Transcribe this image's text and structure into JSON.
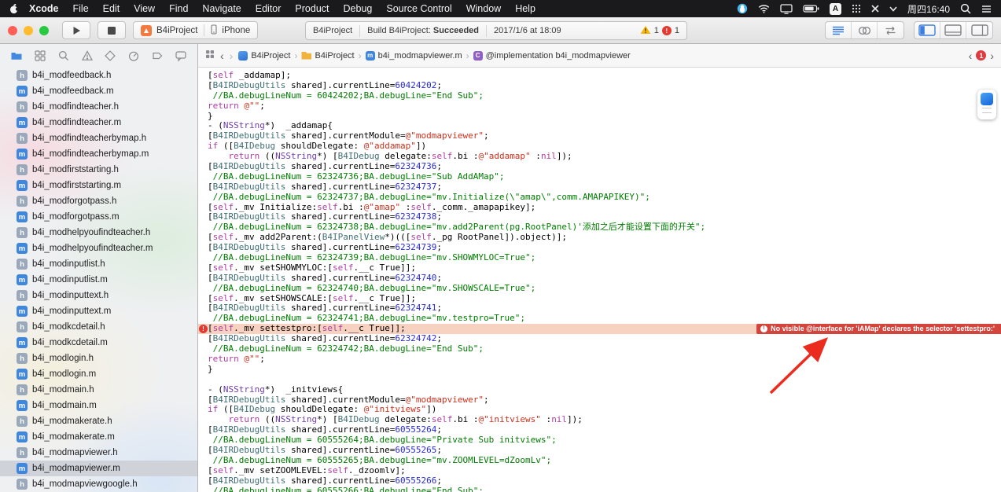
{
  "menubar": {
    "items": [
      "Xcode",
      "File",
      "Edit",
      "View",
      "Find",
      "Navigate",
      "Editor",
      "Product",
      "Debug",
      "Source Control",
      "Window",
      "Help"
    ],
    "status": {
      "time": "周四16:40",
      "input_method": "A"
    }
  },
  "toolbar": {
    "scheme": {
      "project": "B4iProject",
      "device": "iPhone"
    },
    "activity": {
      "project": "B4iProject",
      "build_prefix": "Build B4iProject:",
      "build_result": "Succeeded",
      "timestamp": "2017/1/6 at 18:09",
      "warning_count": "1",
      "error_count": "1"
    }
  },
  "sidebar": {
    "files": [
      {
        "ext": "h",
        "name": "b4i_modfeedback.h"
      },
      {
        "ext": "m",
        "name": "b4i_modfeedback.m"
      },
      {
        "ext": "h",
        "name": "b4i_modfindteacher.h"
      },
      {
        "ext": "m",
        "name": "b4i_modfindteacher.m"
      },
      {
        "ext": "h",
        "name": "b4i_modfindteacherbymap.h"
      },
      {
        "ext": "m",
        "name": "b4i_modfindteacherbymap.m"
      },
      {
        "ext": "h",
        "name": "b4i_modfirststarting.h"
      },
      {
        "ext": "m",
        "name": "b4i_modfirststarting.m"
      },
      {
        "ext": "h",
        "name": "b4i_modforgotpass.h"
      },
      {
        "ext": "m",
        "name": "b4i_modforgotpass.m"
      },
      {
        "ext": "h",
        "name": "b4i_modhelpyoufindteacher.h"
      },
      {
        "ext": "m",
        "name": "b4i_modhelpyoufindteacher.m"
      },
      {
        "ext": "h",
        "name": "b4i_modinputlist.h"
      },
      {
        "ext": "m",
        "name": "b4i_modinputlist.m"
      },
      {
        "ext": "h",
        "name": "b4i_modinputtext.h"
      },
      {
        "ext": "m",
        "name": "b4i_modinputtext.m"
      },
      {
        "ext": "h",
        "name": "b4i_modkcdetail.h"
      },
      {
        "ext": "m",
        "name": "b4i_modkcdetail.m"
      },
      {
        "ext": "h",
        "name": "b4i_modlogin.h"
      },
      {
        "ext": "m",
        "name": "b4i_modlogin.m"
      },
      {
        "ext": "h",
        "name": "b4i_modmain.h"
      },
      {
        "ext": "m",
        "name": "b4i_modmain.m"
      },
      {
        "ext": "h",
        "name": "b4i_modmakerate.h"
      },
      {
        "ext": "m",
        "name": "b4i_modmakerate.m"
      },
      {
        "ext": "h",
        "name": "b4i_modmapviewer.h"
      },
      {
        "ext": "m",
        "name": "b4i_modmapviewer.m",
        "selected": true
      },
      {
        "ext": "h",
        "name": "b4i_modmapviewgoogle.h"
      }
    ]
  },
  "jumpbar": {
    "crumbs": [
      {
        "icon": "project",
        "glyph": "",
        "label": "B4iProject"
      },
      {
        "icon": "folder",
        "glyph": "",
        "label": "B4iProject"
      },
      {
        "icon": "file",
        "glyph": "m",
        "label": "b4i_modmapviewer.m"
      },
      {
        "icon": "class",
        "glyph": "C",
        "label": "@implementation b4i_modmapviewer"
      }
    ],
    "issue_count": "1"
  },
  "editor": {
    "error_banner": "No visible @interface for 'iAMap' declares the selector 'settestpro:'",
    "lines": [
      {
        "seg": [
          [
            "p",
            "["
          ],
          [
            "k",
            "self"
          ],
          [
            "p",
            " _addamap];"
          ]
        ]
      },
      {
        "seg": [
          [
            "p",
            "["
          ],
          [
            "u",
            "B4IRDebugUtils"
          ],
          [
            "p",
            " shared].currentLine="
          ],
          [
            "n",
            "60424202"
          ],
          [
            "p",
            ";"
          ]
        ]
      },
      {
        "seg": [
          [
            "c",
            " //BA.debugLineNum = 60424202;BA.debugLine=\"End Sub\";"
          ]
        ]
      },
      {
        "seg": [
          [
            "k",
            "return"
          ],
          [
            "p",
            " "
          ],
          [
            "s",
            "@\"\""
          ],
          [
            "p",
            ";"
          ]
        ]
      },
      {
        "seg": [
          [
            "p",
            "}"
          ]
        ]
      },
      {
        "seg": [
          [
            "p",
            "- ("
          ],
          [
            "t",
            "NSString"
          ],
          [
            "p",
            "*)  _addamap{"
          ]
        ]
      },
      {
        "seg": [
          [
            "p",
            "["
          ],
          [
            "u",
            "B4IRDebugUtils"
          ],
          [
            "p",
            " shared].currentModule="
          ],
          [
            "s",
            "@\"modmapviewer\""
          ],
          [
            "p",
            ";"
          ]
        ]
      },
      {
        "seg": [
          [
            "k",
            "if"
          ],
          [
            "p",
            " (["
          ],
          [
            "u",
            "B4IDebug"
          ],
          [
            "p",
            " shouldDelegate: "
          ],
          [
            "s",
            "@\"addamap\""
          ],
          [
            "p",
            "])"
          ]
        ]
      },
      {
        "seg": [
          [
            "p",
            "    "
          ],
          [
            "k",
            "return"
          ],
          [
            "p",
            " (("
          ],
          [
            "t",
            "NSString"
          ],
          [
            "p",
            "*) ["
          ],
          [
            "u",
            "B4IDebug"
          ],
          [
            "p",
            " delegate:"
          ],
          [
            "k",
            "self"
          ],
          [
            "p",
            ".bi :"
          ],
          [
            "s",
            "@\"addamap\""
          ],
          [
            "p",
            " :"
          ],
          [
            "k",
            "nil"
          ],
          [
            "p",
            "]);"
          ]
        ]
      },
      {
        "seg": [
          [
            "p",
            "["
          ],
          [
            "u",
            "B4IRDebugUtils"
          ],
          [
            "p",
            " shared].currentLine="
          ],
          [
            "n",
            "62324736"
          ],
          [
            "p",
            ";"
          ]
        ]
      },
      {
        "seg": [
          [
            "c",
            " //BA.debugLineNum = 62324736;BA.debugLine=\"Sub AddAMap\";"
          ]
        ]
      },
      {
        "seg": [
          [
            "p",
            "["
          ],
          [
            "u",
            "B4IRDebugUtils"
          ],
          [
            "p",
            " shared].currentLine="
          ],
          [
            "n",
            "62324737"
          ],
          [
            "p",
            ";"
          ]
        ]
      },
      {
        "seg": [
          [
            "c",
            " //BA.debugLineNum = 62324737;BA.debugLine=\"mv.Initialize(\\\"amap\\\",comm.AMAPAPIKEY)\";"
          ]
        ]
      },
      {
        "seg": [
          [
            "p",
            "["
          ],
          [
            "k",
            "self"
          ],
          [
            "p",
            "._mv Initialize:"
          ],
          [
            "k",
            "self"
          ],
          [
            "p",
            ".bi :"
          ],
          [
            "s",
            "@\"amap\""
          ],
          [
            "p",
            " :"
          ],
          [
            "k",
            "self"
          ],
          [
            "p",
            "._comm._amapapikey];"
          ]
        ]
      },
      {
        "seg": [
          [
            "p",
            "["
          ],
          [
            "u",
            "B4IRDebugUtils"
          ],
          [
            "p",
            " shared].currentLine="
          ],
          [
            "n",
            "62324738"
          ],
          [
            "p",
            ";"
          ]
        ]
      },
      {
        "seg": [
          [
            "c",
            " //BA.debugLineNum = 62324738;BA.debugLine=\"mv.add2Parent(pg.RootPanel)'添加之后才能设置下面的开关\";"
          ]
        ]
      },
      {
        "seg": [
          [
            "p",
            "["
          ],
          [
            "k",
            "self"
          ],
          [
            "p",
            "._mv add2Parent:("
          ],
          [
            "u",
            "B4IPanelView"
          ],
          [
            "p",
            "*)((["
          ],
          [
            "k",
            "self"
          ],
          [
            "p",
            "._pg RootPanel]).object)];"
          ]
        ]
      },
      {
        "seg": [
          [
            "p",
            "["
          ],
          [
            "u",
            "B4IRDebugUtils"
          ],
          [
            "p",
            " shared].currentLine="
          ],
          [
            "n",
            "62324739"
          ],
          [
            "p",
            ";"
          ]
        ]
      },
      {
        "seg": [
          [
            "c",
            " //BA.debugLineNum = 62324739;BA.debugLine=\"mv.SHOWMYLOC=True\";"
          ]
        ]
      },
      {
        "seg": [
          [
            "p",
            "["
          ],
          [
            "k",
            "self"
          ],
          [
            "p",
            "._mv setSHOWMYLOC:["
          ],
          [
            "k",
            "self"
          ],
          [
            "p",
            ".__c True]];"
          ]
        ]
      },
      {
        "seg": [
          [
            "p",
            "["
          ],
          [
            "u",
            "B4IRDebugUtils"
          ],
          [
            "p",
            " shared].currentLine="
          ],
          [
            "n",
            "62324740"
          ],
          [
            "p",
            ";"
          ]
        ]
      },
      {
        "seg": [
          [
            "c",
            " //BA.debugLineNum = 62324740;BA.debugLine=\"mv.SHOWSCALE=True\";"
          ]
        ]
      },
      {
        "seg": [
          [
            "p",
            "["
          ],
          [
            "k",
            "self"
          ],
          [
            "p",
            "._mv setSHOWSCALE:["
          ],
          [
            "k",
            "self"
          ],
          [
            "p",
            ".__c True]];"
          ]
        ]
      },
      {
        "seg": [
          [
            "p",
            "["
          ],
          [
            "u",
            "B4IRDebugUtils"
          ],
          [
            "p",
            " shared].currentLine="
          ],
          [
            "n",
            "62324741"
          ],
          [
            "p",
            ";"
          ]
        ]
      },
      {
        "seg": [
          [
            "c",
            " //BA.debugLineNum = 62324741;BA.debugLine=\"mv.testpro=True\";"
          ]
        ]
      },
      {
        "error": true,
        "seg": [
          [
            "p",
            "["
          ],
          [
            "k",
            "self"
          ],
          [
            "p",
            "._mv settestpro:["
          ],
          [
            "k",
            "self"
          ],
          [
            "p",
            ".__c True]];"
          ]
        ]
      },
      {
        "seg": [
          [
            "p",
            "["
          ],
          [
            "u",
            "B4IRDebugUtils"
          ],
          [
            "p",
            " shared].currentLine="
          ],
          [
            "n",
            "62324742"
          ],
          [
            "p",
            ";"
          ]
        ]
      },
      {
        "seg": [
          [
            "c",
            " //BA.debugLineNum = 62324742;BA.debugLine=\"End Sub\";"
          ]
        ]
      },
      {
        "seg": [
          [
            "k",
            "return"
          ],
          [
            "p",
            " "
          ],
          [
            "s",
            "@\"\""
          ],
          [
            "p",
            ";"
          ]
        ]
      },
      {
        "seg": [
          [
            "p",
            "}"
          ]
        ]
      },
      {
        "seg": []
      },
      {
        "seg": [
          [
            "p",
            "- ("
          ],
          [
            "t",
            "NSString"
          ],
          [
            "p",
            "*)  _initviews{"
          ]
        ]
      },
      {
        "seg": [
          [
            "p",
            "["
          ],
          [
            "u",
            "B4IRDebugUtils"
          ],
          [
            "p",
            " shared].currentModule="
          ],
          [
            "s",
            "@\"modmapviewer\""
          ],
          [
            "p",
            ";"
          ]
        ]
      },
      {
        "seg": [
          [
            "k",
            "if"
          ],
          [
            "p",
            " (["
          ],
          [
            "u",
            "B4IDebug"
          ],
          [
            "p",
            " shouldDelegate: "
          ],
          [
            "s",
            "@\"initviews\""
          ],
          [
            "p",
            "])"
          ]
        ]
      },
      {
        "seg": [
          [
            "p",
            "    "
          ],
          [
            "k",
            "return"
          ],
          [
            "p",
            " (("
          ],
          [
            "t",
            "NSString"
          ],
          [
            "p",
            "*) ["
          ],
          [
            "u",
            "B4IDebug"
          ],
          [
            "p",
            " delegate:"
          ],
          [
            "k",
            "self"
          ],
          [
            "p",
            ".bi :"
          ],
          [
            "s",
            "@\"initviews\""
          ],
          [
            "p",
            " :"
          ],
          [
            "k",
            "nil"
          ],
          [
            "p",
            "]);"
          ]
        ]
      },
      {
        "seg": [
          [
            "p",
            "["
          ],
          [
            "u",
            "B4IRDebugUtils"
          ],
          [
            "p",
            " shared].currentLine="
          ],
          [
            "n",
            "60555264"
          ],
          [
            "p",
            ";"
          ]
        ]
      },
      {
        "seg": [
          [
            "c",
            " //BA.debugLineNum = 60555264;BA.debugLine=\"Private Sub initviews\";"
          ]
        ]
      },
      {
        "seg": [
          [
            "p",
            "["
          ],
          [
            "u",
            "B4IRDebugUtils"
          ],
          [
            "p",
            " shared].currentLine="
          ],
          [
            "n",
            "60555265"
          ],
          [
            "p",
            ";"
          ]
        ]
      },
      {
        "seg": [
          [
            "c",
            " //BA.debugLineNum = 60555265;BA.debugLine=\"mv.ZOOMLEVEL=dZoomLv\";"
          ]
        ]
      },
      {
        "seg": [
          [
            "p",
            "["
          ],
          [
            "k",
            "self"
          ],
          [
            "p",
            "._mv setZOOMLEVEL:"
          ],
          [
            "k",
            "self"
          ],
          [
            "p",
            "._dzoomlv];"
          ]
        ]
      },
      {
        "seg": [
          [
            "p",
            "["
          ],
          [
            "u",
            "B4IRDebugUtils"
          ],
          [
            "p",
            " shared].currentLine="
          ],
          [
            "n",
            "60555266"
          ],
          [
            "p",
            ";"
          ]
        ]
      },
      {
        "seg": [
          [
            "c",
            " //BA.debugLineNum = 60555266;BA.debugLine=\"End Sub\";"
          ]
        ]
      }
    ]
  }
}
